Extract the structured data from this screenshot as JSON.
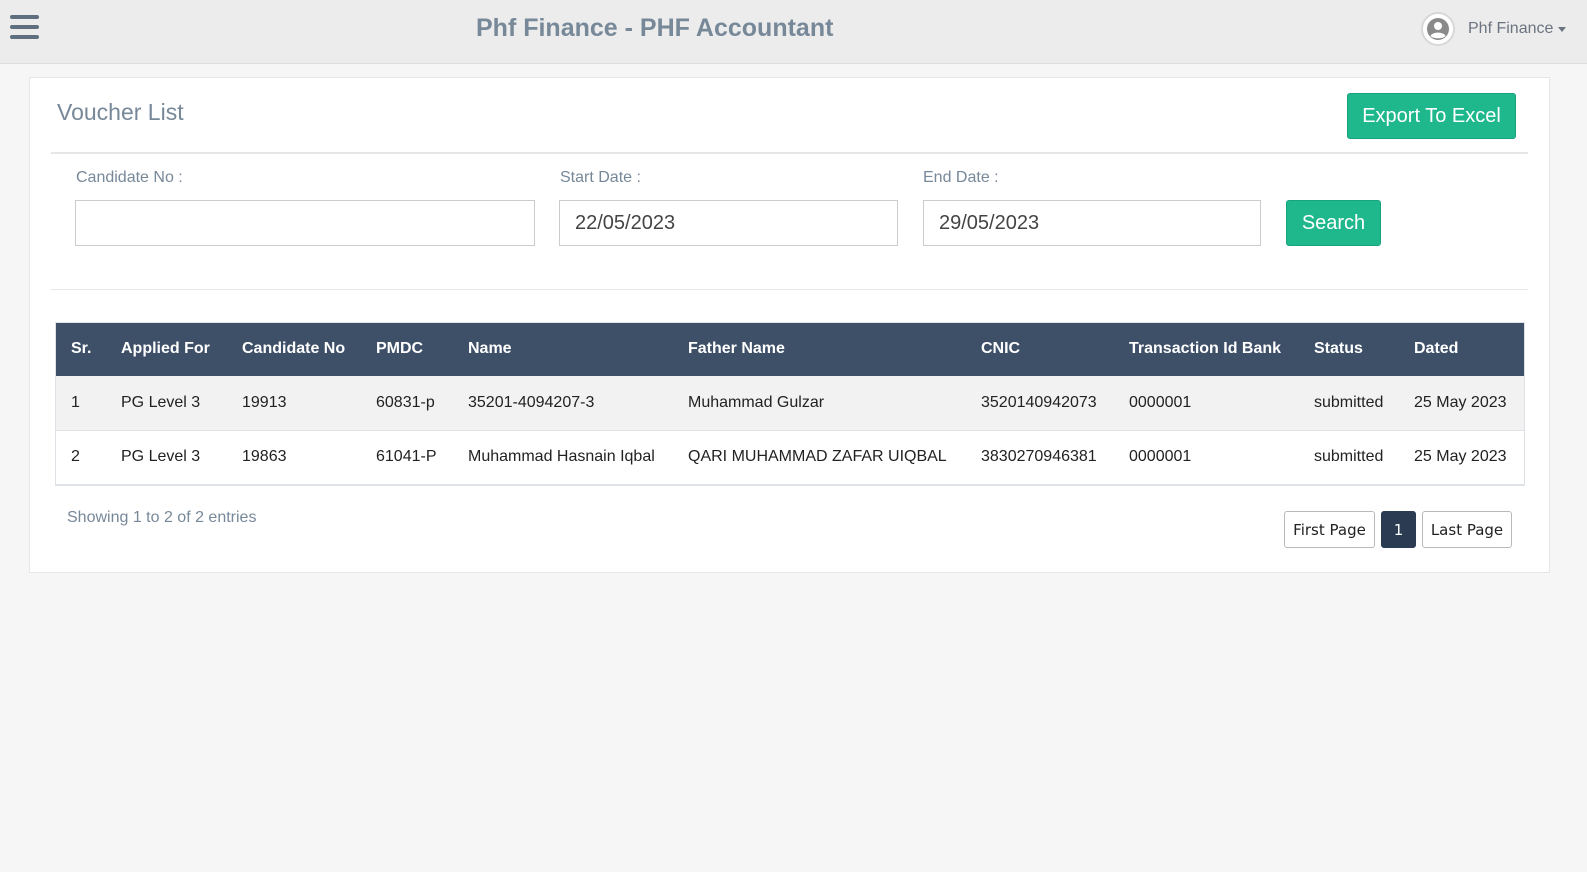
{
  "header": {
    "title": "Phf Finance - PHF Accountant",
    "user_name": "Phf Finance"
  },
  "page": {
    "title": "Voucher List",
    "export_label": "Export To Excel"
  },
  "filters": {
    "candidate_label": "Candidate No :",
    "candidate_value": "",
    "start_label": "Start Date :",
    "start_value": "22/05/2023",
    "end_label": "End Date :",
    "end_value": "29/05/2023",
    "search_label": "Search"
  },
  "table": {
    "columns": [
      "Sr.",
      "Applied For",
      "Candidate No",
      "PMDC",
      "Name",
      "Father Name",
      "CNIC",
      "Transaction Id Bank",
      "Status",
      "Dated"
    ],
    "rows": [
      [
        "1",
        "PG Level 3",
        "19913",
        "60831-p",
        "35201-4094207-3",
        "Muhammad Gulzar",
        "3520140942073",
        "0000001",
        "submitted",
        "25 May 2023"
      ],
      [
        "2",
        "PG Level 3",
        "19863",
        "61041-P",
        "Muhammad Hasnain Iqbal",
        "QARI MUHAMMAD ZAFAR UIQBAL",
        "3830270946381",
        "0000001",
        "submitted",
        "25 May 2023"
      ]
    ]
  },
  "pagination": {
    "summary": "Showing 1 to 2 of 2 entries",
    "first_label": "First Page",
    "current_page": "1",
    "last_label": "Last Page"
  },
  "colors": {
    "accent_green": "#1fb88d",
    "table_header": "#3e5068",
    "active_page": "#2a3b52"
  }
}
